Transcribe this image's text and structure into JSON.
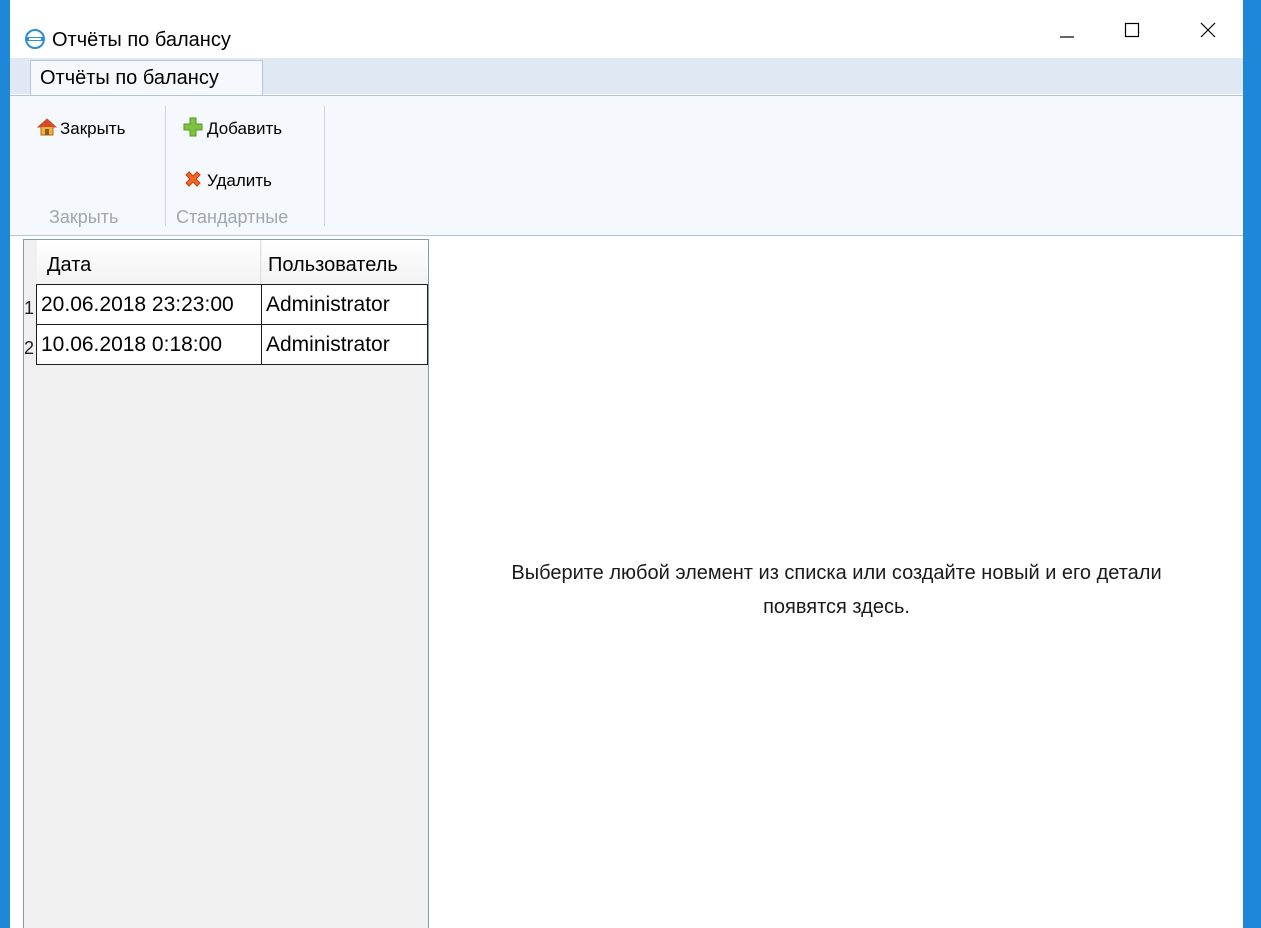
{
  "window": {
    "title": "Отчёты по балансу",
    "controls": {
      "minimize": "minimize-icon",
      "maximize": "maximize-icon",
      "close": "close-icon"
    }
  },
  "ribbon": {
    "tab_label": "Отчёты по балансу",
    "groups": [
      {
        "label": "Закрыть",
        "buttons": [
          {
            "label": "Закрыть",
            "icon": "home-icon"
          }
        ]
      },
      {
        "label": "Стандартные",
        "buttons": [
          {
            "label": "Добавить",
            "icon": "plus-icon"
          },
          {
            "label": "Удалить",
            "icon": "delete-x-icon"
          }
        ]
      }
    ]
  },
  "list": {
    "columns": [
      "Дата",
      "Пользователь"
    ],
    "rows": [
      {
        "num": "1",
        "date": "20.06.2018 23:23:00",
        "user": "Administrator"
      },
      {
        "num": "2",
        "date": "10.06.2018 0:18:00",
        "user": "Administrator"
      }
    ]
  },
  "detail": {
    "line1": "Выберите любой элемент из списка или создайте новый и его детали",
    "line2": "появятся здесь."
  },
  "colors": {
    "frame": "#1e87d8",
    "ribbon_bg": "#f5f8fc",
    "tab_strip": "#dfe8f3",
    "panel_bg": "#f0f0f0",
    "add_green": "#7dc242",
    "delete_orange": "#f26522"
  }
}
